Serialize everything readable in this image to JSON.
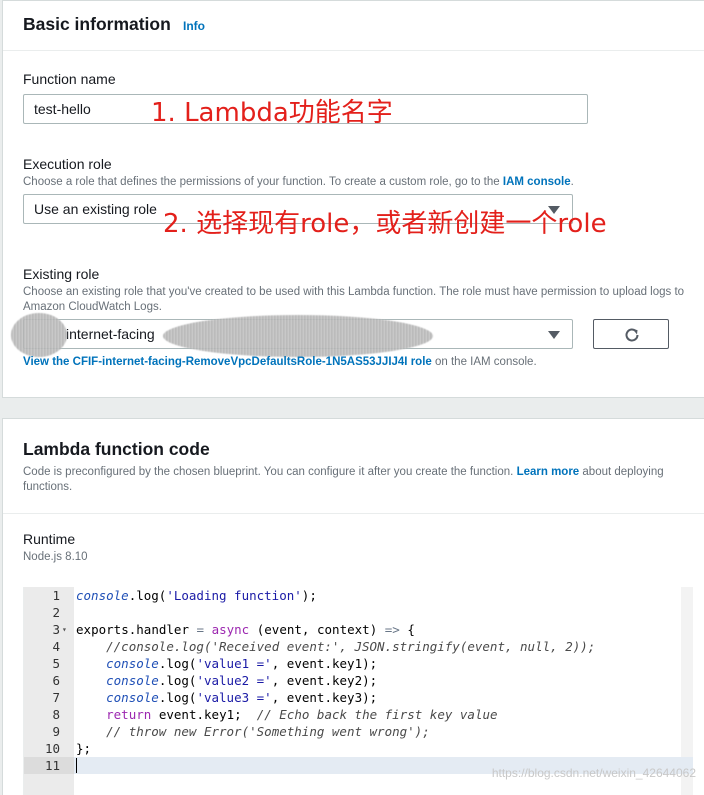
{
  "basic": {
    "title": "Basic information",
    "info": "Info",
    "function_name_label": "Function name",
    "function_name_value": "test-hello",
    "annotation1": "1. Lambda功能名字",
    "execution_role_label": "Execution role",
    "execution_role_desc": "Choose a role that defines the permissions of your function. To create a custom role, go to the",
    "iam_console_link": "IAM console",
    "execution_role_desc_end": ".",
    "execution_role_value": "Use an existing role",
    "annotation2": "2. 选择现有role，或者新创建一个role",
    "existing_role_label": "Existing role",
    "existing_role_desc": "Choose an existing role that you've created to be used with this Lambda function. The role must have permission to upload logs to Amazon CloudWatch Logs.",
    "existing_role_value": "internet-facing",
    "view_role_link": "View the CFIF-internet-facing-RemoveVpcDefaultsRole-1N5AS53JJIJ4I role",
    "view_role_suffix": " on the IAM console."
  },
  "code": {
    "title": "Lambda function code",
    "desc": "Code is preconfigured by the chosen blueprint. You can configure it after you create the function.",
    "learn_more": "Learn more",
    "desc_end": " about deploying functions.",
    "runtime_label": "Runtime",
    "runtime_value": "Node.js 8.10",
    "lines": [
      "console.log('Loading function');",
      "",
      "exports.handler = async (event, context) => {",
      "    //console.log('Received event:', JSON.stringify(event, null, 2));",
      "    console.log('value1 =', event.key1);",
      "    console.log('value2 =', event.key2);",
      "    console.log('value3 =', event.key3);",
      "    return event.key1;  // Echo back the first key value",
      "    // throw new Error('Something went wrong');",
      "};",
      ""
    ]
  },
  "watermark": "https://blog.csdn.net/weixin_42644062"
}
